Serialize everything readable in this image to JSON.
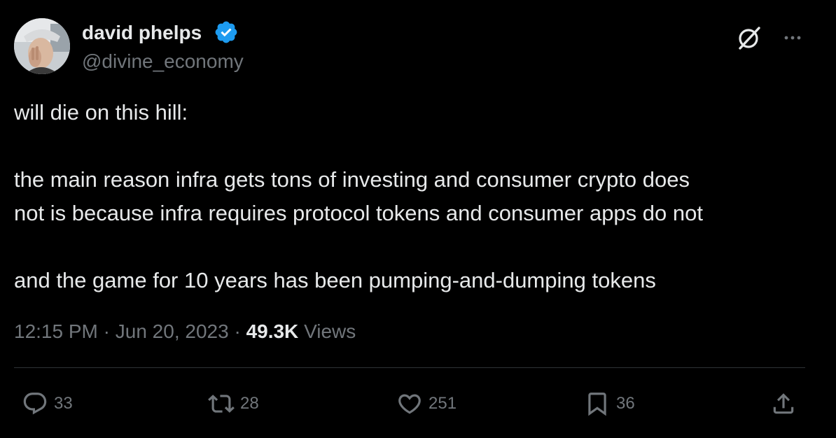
{
  "author": {
    "name": "david phelps",
    "handle": "@divine_economy",
    "verified_color": "#1d9bf0"
  },
  "icons": {
    "header_right": [
      "grok-icon",
      "more-icon"
    ],
    "actions": [
      "reply-icon",
      "retweet-icon",
      "like-icon",
      "bookmark-icon",
      "share-icon"
    ]
  },
  "tweet": {
    "paragraphs": [
      "will die on this hill:",
      "the main reason infra gets tons of investing and consumer crypto does\nnot is because infra requires protocol tokens and consumer apps do not",
      "and the game for 10 years has been pumping-and-dumping tokens"
    ]
  },
  "meta": {
    "time": "12:15 PM",
    "separator": "·",
    "date": "Jun 20, 2023",
    "views_count": "49.3K",
    "views_label": "Views"
  },
  "actions": {
    "replies": "33",
    "retweets": "28",
    "likes": "251",
    "bookmarks": "36"
  },
  "colors": {
    "background": "#000000",
    "text": "#e7e9ea",
    "secondary": "#71767b",
    "divider": "#2f3336",
    "verified": "#1d9bf0"
  }
}
